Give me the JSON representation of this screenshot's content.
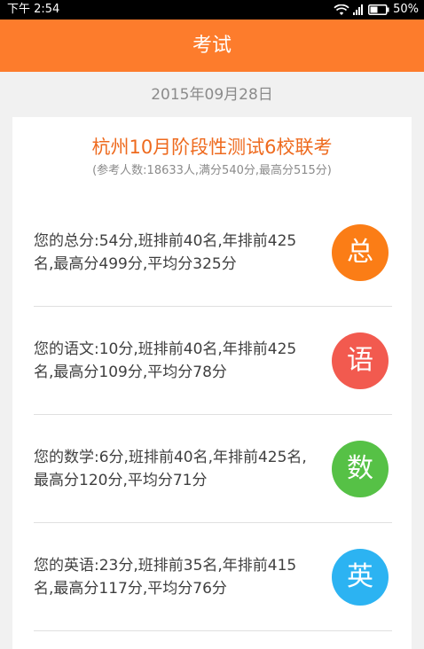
{
  "status_bar": {
    "time": "下午 2:54",
    "battery": "50%"
  },
  "header": {
    "title": "考试"
  },
  "date": "2015年09月28日",
  "exam": {
    "title": "杭州10月阶段性测试6校联考",
    "meta": "(参考人数:18633人,满分540分,最高分515分)",
    "scores": [
      {
        "text": "您的总分:54分,班排前40名,年排前425名,最高分499分,平均分325分",
        "badge": "总",
        "color": "#fb7d16"
      },
      {
        "text": "您的语文:10分,班排前40名,年排前425名,最高分109分,平均分78分",
        "badge": "语",
        "color": "#f25a4f"
      },
      {
        "text": "您的数学:6分,班排前40名,年排前425名,最高分120分,平均分71分",
        "badge": "数",
        "color": "#56c146"
      },
      {
        "text": "您的英语:23分,班排前35名,年排前415名,最高分117分,平均分76分",
        "badge": "英",
        "color": "#2cb3f2"
      }
    ]
  }
}
